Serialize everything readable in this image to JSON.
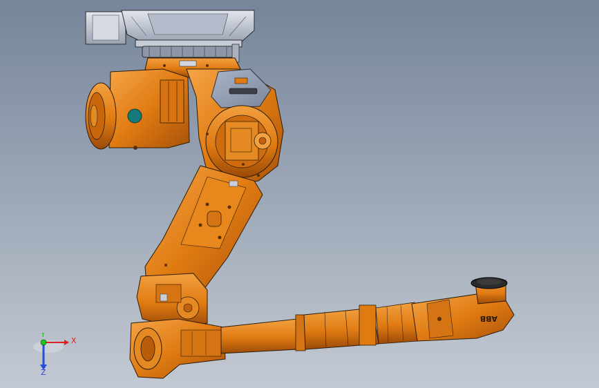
{
  "viewport": {
    "background_top": "#76859a",
    "background_bottom": "#c3c9d2"
  },
  "model": {
    "name": "robot-arm",
    "part_color": "#e07b12",
    "part_shade": "#a8520a",
    "part_light": "#f2a040",
    "edge_color": "#2a1a08",
    "base_color": "#c6ccd8",
    "cover_color": "#98a2b6",
    "wrist_dark": "#1e1e1e",
    "brand_text": "ABB"
  },
  "triad": {
    "x_label": "X",
    "y_label": "Y",
    "z_label": "Z",
    "x_color": "#e02020",
    "y_color": "#20c020",
    "z_color": "#2a4ad8"
  }
}
